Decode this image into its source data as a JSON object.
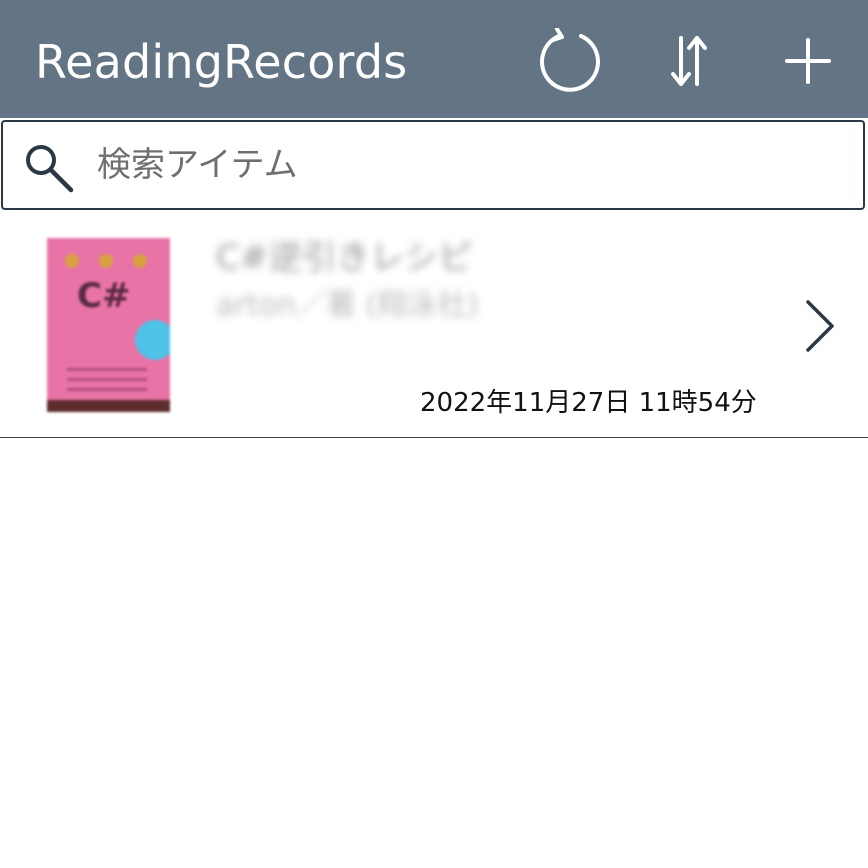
{
  "header": {
    "title": "ReadingRecords",
    "background": "#637585",
    "refresh_icon": "refresh-icon",
    "sort_icon": "sort-icon",
    "add_icon": "add-icon"
  },
  "search": {
    "placeholder": "検索アイテム",
    "value": "",
    "icon": "search-icon"
  },
  "items": [
    {
      "title": "C#逆引きレシピ",
      "author": "arton／著 (翔泳社)",
      "timestamp": "2022年11月27日 11時54分",
      "cover_icon": "book-cover-image"
    }
  ]
}
